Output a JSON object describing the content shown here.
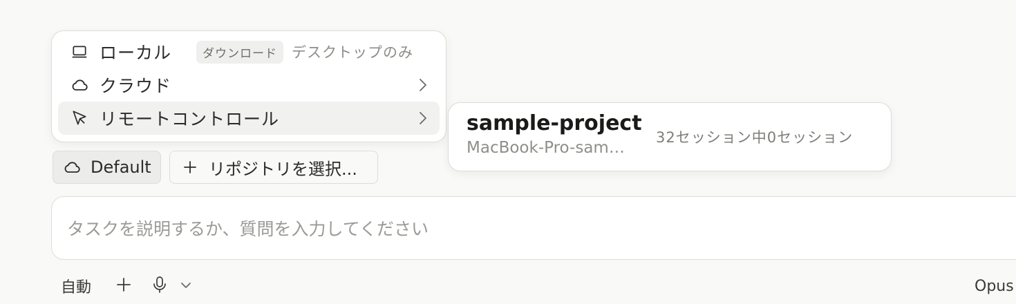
{
  "menu": {
    "items": [
      {
        "label": "ローカル",
        "badge": "ダウンロード",
        "note": "デスクトップのみ"
      },
      {
        "label": "クラウド"
      },
      {
        "label": "リモートコントロール"
      }
    ]
  },
  "submenu": {
    "project_name": "sample-project",
    "host": "MacBook-Pro-sam…",
    "sessions": "32セッション中0セッション"
  },
  "chips": {
    "environment": "Default",
    "repo": "リポジトリを選択..."
  },
  "prompt": {
    "placeholder": "タスクを説明するか、質問を入力してください"
  },
  "toolbar": {
    "mode": "自動",
    "model": "Opus"
  },
  "colors": {
    "background": "#f9f9f7",
    "surface": "#ffffff",
    "border": "#dcdcd8",
    "hover": "#f1f1ef",
    "muted_text": "#8c8c88"
  },
  "icons": [
    "laptop-icon",
    "cloud-icon",
    "cursor-icon",
    "chevron-right-icon",
    "plus-icon",
    "microphone-icon",
    "chevron-down-icon"
  ]
}
